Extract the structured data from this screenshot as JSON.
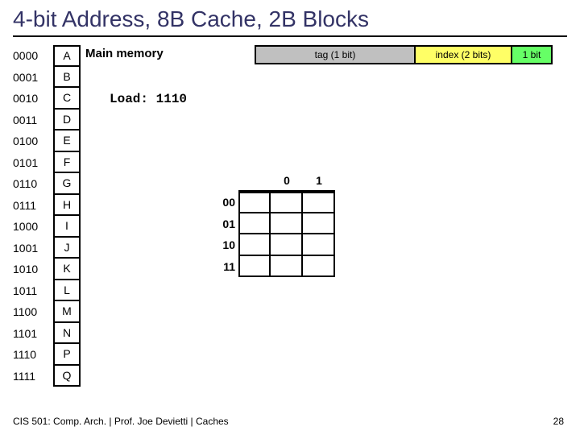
{
  "title": "4-bit Address, 8B Cache, 2B Blocks",
  "main_memory_label": "Main memory",
  "load_label": "Load: 1110",
  "address_format": {
    "tag": "tag (1 bit)",
    "index": "index (2 bits)",
    "offset": "1 bit"
  },
  "memory": [
    {
      "addr": "0000",
      "val": "A"
    },
    {
      "addr": "0001",
      "val": "B"
    },
    {
      "addr": "0010",
      "val": "C"
    },
    {
      "addr": "0011",
      "val": "D"
    },
    {
      "addr": "0100",
      "val": "E"
    },
    {
      "addr": "0101",
      "val": "F"
    },
    {
      "addr": "0110",
      "val": "G"
    },
    {
      "addr": "0111",
      "val": "H"
    },
    {
      "addr": "1000",
      "val": "I"
    },
    {
      "addr": "1001",
      "val": "J"
    },
    {
      "addr": "1010",
      "val": "K"
    },
    {
      "addr": "1011",
      "val": "L"
    },
    {
      "addr": "1100",
      "val": "M"
    },
    {
      "addr": "1101",
      "val": "N"
    },
    {
      "addr": "1110",
      "val": "P"
    },
    {
      "addr": "1111",
      "val": "Q"
    }
  ],
  "cache": {
    "row_labels": [
      "00",
      "01",
      "10",
      "11"
    ],
    "col_labels": [
      "0",
      "1"
    ]
  },
  "footer": "CIS 501: Comp. Arch.  |  Prof. Joe Devietti  |  Caches",
  "page_number": "28"
}
